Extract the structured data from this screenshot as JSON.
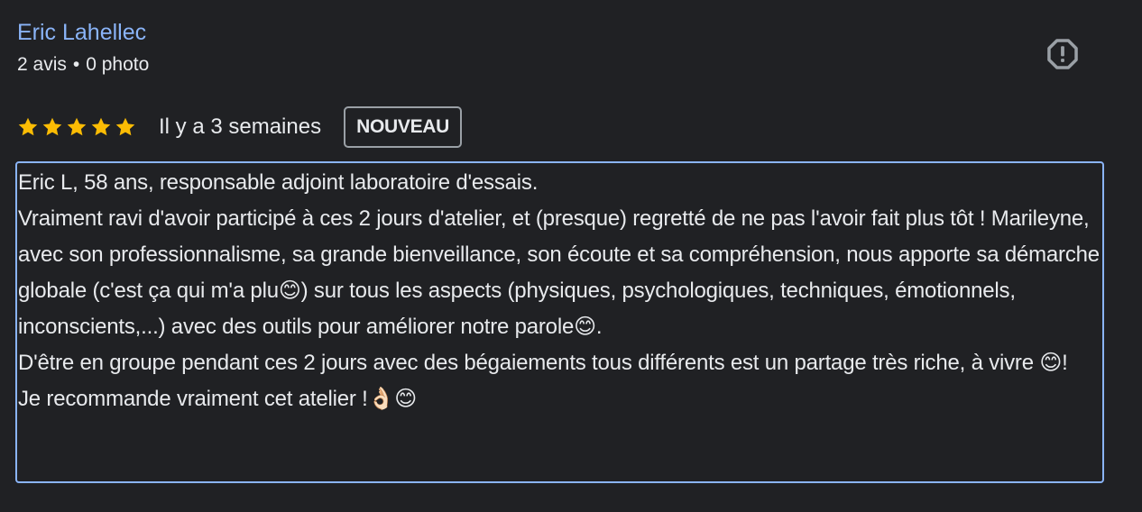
{
  "author": {
    "name": "Eric Lahellec",
    "review_count": "2 avis",
    "separator": "•",
    "photo_count": "0 photo"
  },
  "report_icon": "report-flag-icon",
  "rating": {
    "stars": 5,
    "max_stars": 5,
    "star_color": "#fbbc04",
    "time_ago": "Il y a 3 semaines",
    "badge": "NOUVEAU"
  },
  "review": {
    "lines": [
      "Eric L, 58 ans, responsable adjoint laboratoire d'essais.",
      "Vraiment ravi d'avoir participé à ces 2 jours d'atelier, et (presque) regretté de ne pas l'avoir fait plus tôt ! Marileyne, avec son professionnalisme, sa grande bienveillance, son écoute et sa compréhension, nous apporte sa démarche globale (c'est ça qui m'a plu😊) sur tous les aspects (physiques, psychologiques, techniques, émotionnels, inconscients,...) avec des outils pour améliorer notre parole😊.",
      "D'être en groupe pendant ces 2 jours avec des bégaiements tous différents est un partage très riche, à vivre 😊!",
      "Je recommande vraiment cet atelier !👌🏻😊"
    ]
  },
  "colors": {
    "background": "#202124",
    "link": "#8ab4f8",
    "text": "#e8eaed",
    "focus_border": "#8ab4f8"
  }
}
